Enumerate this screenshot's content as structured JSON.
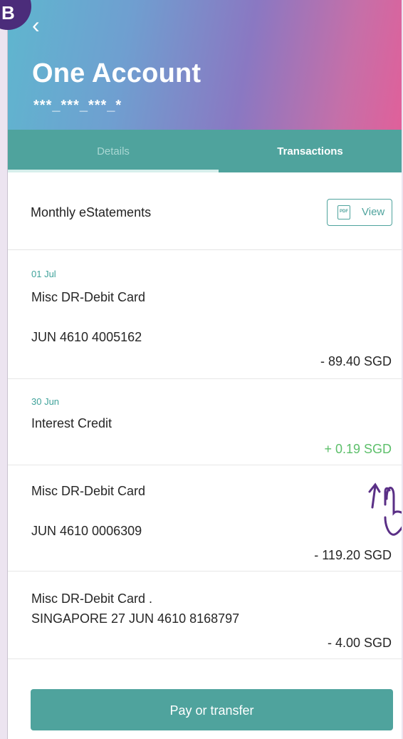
{
  "header": {
    "back_icon": "chevron-left-icon",
    "title": "One Account",
    "account_number": "***_***_***_*"
  },
  "tabs": [
    {
      "label": "Details",
      "active": false
    },
    {
      "label": "Transactions",
      "active": true
    }
  ],
  "statements": {
    "label": "Monthly eStatements",
    "view_label": "View",
    "view_icon": "pdf-icon"
  },
  "transactions": [
    {
      "date": "01 Jul",
      "description": "Misc DR-Debit Card",
      "detail": "JUN 4610 4005162",
      "amount": "- 89.40 SGD"
    },
    {
      "date": "30 Jun",
      "description": "Interest Credit",
      "detail": "",
      "amount": "+ 0.19 SGD"
    },
    {
      "date": "",
      "description": "Misc DR-Debit Card",
      "detail": "JUN 4610 0006309",
      "amount": "- 119.20 SGD"
    },
    {
      "date": "",
      "description": "Misc DR-Debit Card .",
      "detail": "SINGAPORE 27 JUN 4610 8168797",
      "amount": "- 4.00 SGD"
    }
  ],
  "footer": {
    "pay_label": "Pay or transfer"
  },
  "badge": {
    "letter": "B"
  },
  "colors": {
    "teal": "#4fa39d",
    "positive": "#5cbf6a",
    "badge": "#4b2c7a"
  }
}
